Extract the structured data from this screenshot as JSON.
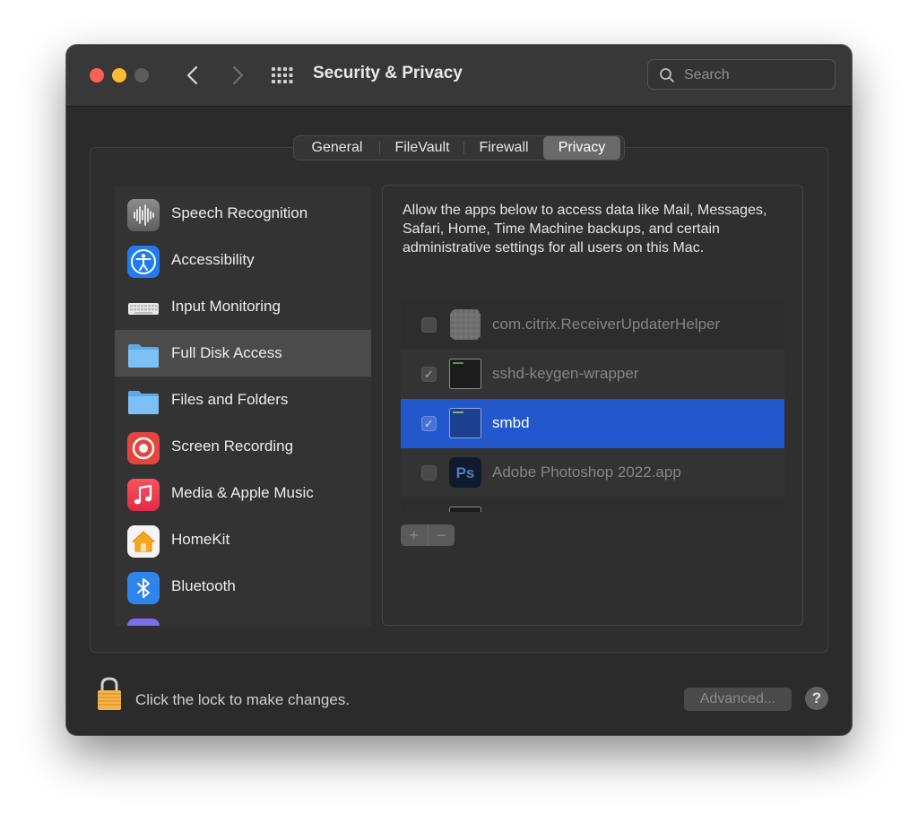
{
  "window": {
    "title": "Security & Privacy",
    "search_placeholder": "Search"
  },
  "tabs": [
    {
      "label": "General",
      "active": false
    },
    {
      "label": "FileVault",
      "active": false
    },
    {
      "label": "Firewall",
      "active": false
    },
    {
      "label": "Privacy",
      "active": true
    }
  ],
  "sidebar": {
    "items": [
      {
        "label": "Speech Recognition",
        "icon": "waveform-icon"
      },
      {
        "label": "Accessibility",
        "icon": "accessibility-icon"
      },
      {
        "label": "Input Monitoring",
        "icon": "keyboard-icon"
      },
      {
        "label": "Full Disk Access",
        "icon": "folder-icon",
        "selected": true
      },
      {
        "label": "Files and Folders",
        "icon": "folder-icon"
      },
      {
        "label": "Screen Recording",
        "icon": "record-icon"
      },
      {
        "label": "Media & Apple Music",
        "icon": "music-note-icon"
      },
      {
        "label": "HomeKit",
        "icon": "home-icon"
      },
      {
        "label": "Bluetooth",
        "icon": "bluetooth-icon"
      }
    ]
  },
  "main": {
    "description": "Allow the apps below to access data like Mail, Messages, Safari, Home, Time Machine backups, and certain administrative settings for all users on this Mac.",
    "apps": [
      {
        "name": "com.citrix.ReceiverUpdaterHelper",
        "checked": false,
        "icon": "generic-app-icon"
      },
      {
        "name": "sshd-keygen-wrapper",
        "checked": true,
        "icon": "terminal-icon"
      },
      {
        "name": "smbd",
        "checked": true,
        "icon": "terminal-icon",
        "selected": true
      },
      {
        "name": "Adobe Photoshop 2022.app",
        "checked": false,
        "icon": "photoshop-icon",
        "icon_text": "Ps"
      }
    ],
    "add_label": "+",
    "remove_label": "−"
  },
  "footer": {
    "lock_text": "Click the lock to make changes.",
    "advanced_label": "Advanced...",
    "help_label": "?"
  },
  "colors": {
    "selection_blue": "#2358cc",
    "close": "#fe5f57",
    "minimize": "#febc2e"
  }
}
